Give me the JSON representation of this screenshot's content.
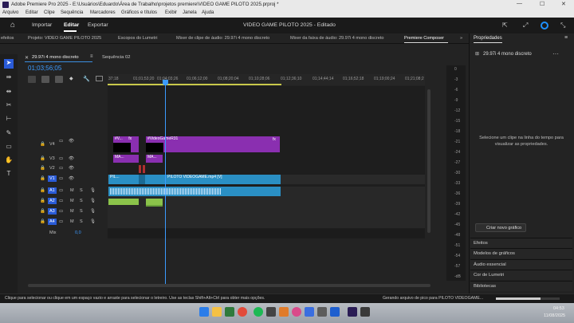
{
  "window": {
    "title_left": "Adobe Premiere Pro 2025 - E:\\Usuários\\Eduardo\\Área de Trabalho\\projetos premiere\\VIDEO GAME PILOTO 2025.prproj *"
  },
  "menu": [
    "Arquivo",
    "Editar",
    "Clipe",
    "Sequência",
    "Marcadores",
    "Gráficos e títulos",
    "Exibir",
    "Janela",
    "Ajuda"
  ],
  "header": {
    "home_icon": "home-icon",
    "import": "Importar",
    "edit": "Editar",
    "export": "Exportar",
    "project_title": "VIDEO GAME PILOTO 2025 - Editado"
  },
  "tabs": [
    "efeitos",
    "Projeto: VIDEO GAME PILOTO 2025",
    "Escopos do Lumetri",
    "Mixer de clipe de áudio: 29.97i 4 mono discreto",
    "Mixer da faixa de áudio: 29.97i 4 mono discreto",
    "Premiere Composer"
  ],
  "timeline": {
    "sequence_tab_active": "29.97i 4 mono discreto",
    "sequence_tab_other": "Sequência 02",
    "timecode": "01;03;56;05",
    "ruler_ticks": [
      "37;18",
      "01;01;53;20",
      "01;04;03;26",
      "01;06;12;00",
      "01;08;20;04",
      "01;10;28;06",
      "01;12;36;10",
      "01;14;44;14",
      "01;16;52;18",
      "01;19;00;24",
      "01;21;08;2"
    ],
    "video_tracks": [
      "V4",
      "V3",
      "V2",
      "V1"
    ],
    "audio_tracks": [
      "A1",
      "A2",
      "A3",
      "A4"
    ],
    "mix_label": "Mix",
    "mix_value": "0,0",
    "track_btn_m": "M",
    "track_btn_s": "S",
    "clips": {
      "v4_a": "#V...",
      "v4_b": "#VideoGameR31",
      "v3_a": "MA...",
      "v3_b": "MA...",
      "v1_a": "PIL...",
      "v1_b": "PILOTO VIDEOGAME.mp4 [V]",
      "fx": "fx"
    }
  },
  "meters": {
    "ticks": [
      "0",
      "-3",
      "-6",
      "-9",
      "-12",
      "-15",
      "-18",
      "-21",
      "-24",
      "-27",
      "-30",
      "-33",
      "-36",
      "-39",
      "-42",
      "-45",
      "-48",
      "-51",
      "-54",
      "-57",
      "-dB"
    ]
  },
  "properties": {
    "title": "Propriedades",
    "sequence": "29.97i 4 mono discreto",
    "empty_message": "Selecione um clipe na linha do tempo para visualizar as propriedades.",
    "create_graphic": "Criar novo gráfico",
    "panels": [
      "Efeitos",
      "Modelos de gráficos",
      "Áudio essencial",
      "Cor de Lumetri",
      "Bibliotecas"
    ]
  },
  "status": {
    "hint": "Clique para selecionar ou clique em um espaço vazio e arraste para selecionar o letreiro. Use as teclas Shift+Alt+Ctrl para obter mais opções.",
    "progress_text": "Gerando arquivo de pico para PILOTO VIDEOGAME...",
    "progress": 0.7
  },
  "taskbar": {
    "time": "04:53",
    "date": "11/08/2025"
  }
}
